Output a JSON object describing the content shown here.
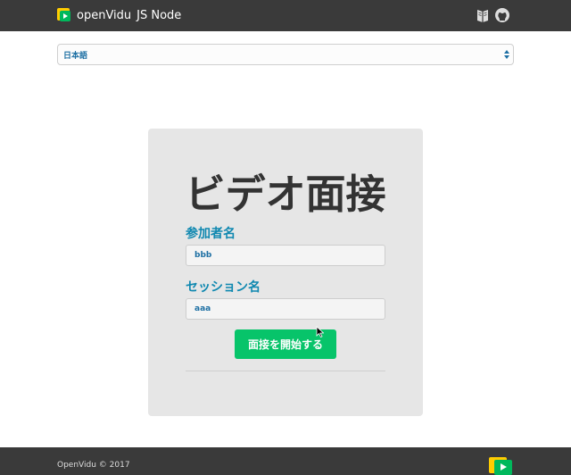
{
  "navbar": {
    "brand_name": "openVidu",
    "brand_sub": "JS Node",
    "icons": [
      "book-icon",
      "github-icon"
    ]
  },
  "language_select": {
    "selected": "日本語"
  },
  "card": {
    "title": "ビデオ面接",
    "participant_label": "参加者名",
    "participant_value": "bbb",
    "session_label": "セッション名",
    "session_value": "aaa",
    "join_button": "面接を開始する"
  },
  "footer": {
    "copyright": "OpenVidu © 2017"
  },
  "colors": {
    "navbar": "#3a3a3a",
    "label": "#0f88b0",
    "button": "#07c46a",
    "card": "#e6e6e6"
  }
}
